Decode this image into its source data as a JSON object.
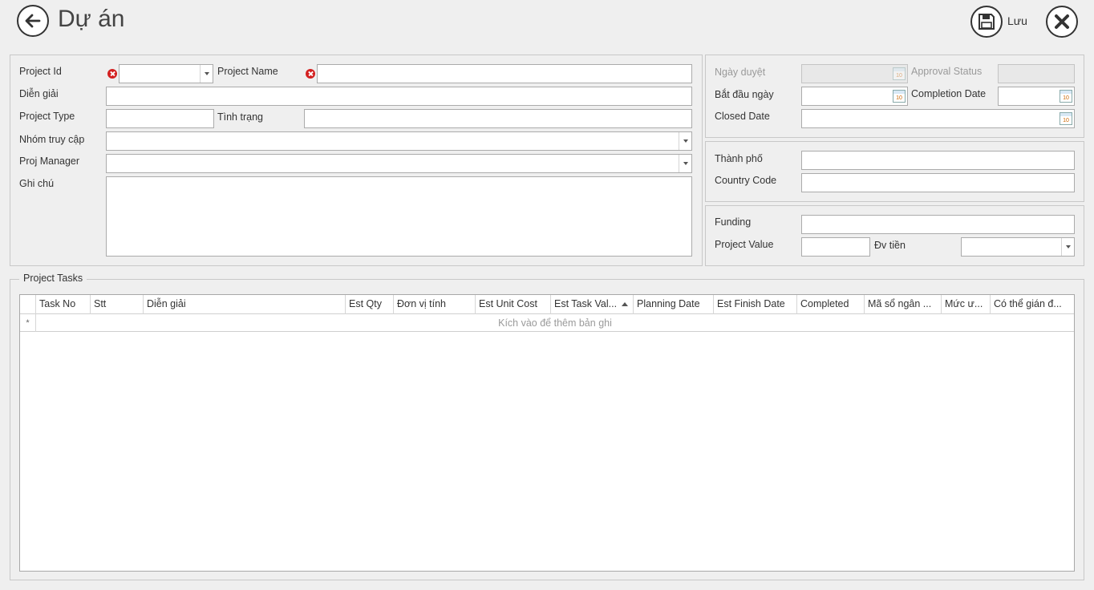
{
  "header": {
    "title": "Dự án",
    "save_label": "Lưu"
  },
  "general": {
    "project_id_label": "Project Id",
    "project_name_label": "Project Name",
    "description_label": "Diễn giải",
    "project_type_label": "Project Type",
    "status_label": "Tình trạng",
    "access_group_label": "Nhóm truy cập",
    "proj_manager_label": "Proj Manager",
    "notes_label": "Ghi chú"
  },
  "dates": {
    "approval_date_label": "Ngày duyệt",
    "approval_status_label": "Approval Status",
    "start_date_label": "Bắt đầu ngày",
    "completion_date_label": "Completion Date",
    "closed_date_label": "Closed Date"
  },
  "location": {
    "city_label": "Thành phố",
    "country_code_label": "Country Code"
  },
  "finance": {
    "funding_label": "Funding",
    "project_value_label": "Project Value",
    "currency_label": "Đv tiền"
  },
  "tasks": {
    "group_title": "Project Tasks",
    "columns": [
      "Task No",
      "Stt",
      "Diễn giải",
      "Est Qty",
      "Đơn vị tính",
      "Est Unit Cost",
      "Est Task Val...",
      "Planning Date",
      "Est Finish Date",
      "Completed",
      "Mã sổ ngân ...",
      "Mức ư...",
      "Có thể gián đ..."
    ],
    "new_row_marker": "*",
    "new_row_text": "Kích vào để thêm bản ghi"
  },
  "icons": {
    "back": "arrow-left-icon",
    "save": "floppy-disk-icon",
    "close": "close-x-icon",
    "error": "error-icon",
    "calendar": "calendar-icon"
  },
  "colors": {
    "error_red": "#d32020",
    "background": "#efefef"
  }
}
